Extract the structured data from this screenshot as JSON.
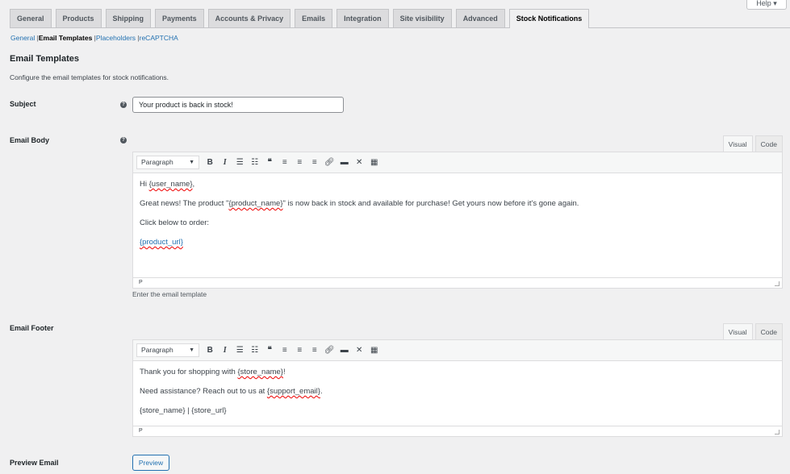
{
  "help_label": "Help ▾",
  "tabs": [
    "General",
    "Products",
    "Shipping",
    "Payments",
    "Accounts & Privacy",
    "Emails",
    "Integration",
    "Site visibility",
    "Advanced",
    "Stock Notifications"
  ],
  "subnav": {
    "general": "General",
    "email_templates": "Email Templates",
    "placeholders": "Placeholders",
    "recaptcha": "reCAPTCHA",
    "sep": "|"
  },
  "section": {
    "title": "Email Templates",
    "description": "Configure the email templates for stock notifications."
  },
  "subject": {
    "label": "Subject",
    "value": "Your product is back in stock!"
  },
  "editor": {
    "visual": "Visual",
    "code": "Code",
    "format": "Paragraph",
    "path": "P"
  },
  "body": {
    "label": "Email Body",
    "greet_pre": "Hi ",
    "greet_ph": "{user_name}",
    "greet_post": ",",
    "l2_pre": "Great news! The product \"",
    "l2_ph": "{product_name}",
    "l2_post": "\" is now back in stock and available for purchase! Get yours now before it's gone again.",
    "l3": "Click below to order:",
    "l4": "{product_url}",
    "hint": "Enter the email template"
  },
  "footer": {
    "label": "Email Footer",
    "l1_pre": "Thank you for shopping with ",
    "l1_ph": "{store_name}",
    "l1_post": "!",
    "l2_pre": "Need assistance? Reach out to us at ",
    "l2_ph": "{support_email}",
    "l2_post": ".",
    "l3": "{store_name} | {store_url}"
  },
  "preview": {
    "label": "Preview Email",
    "button": "Preview"
  }
}
